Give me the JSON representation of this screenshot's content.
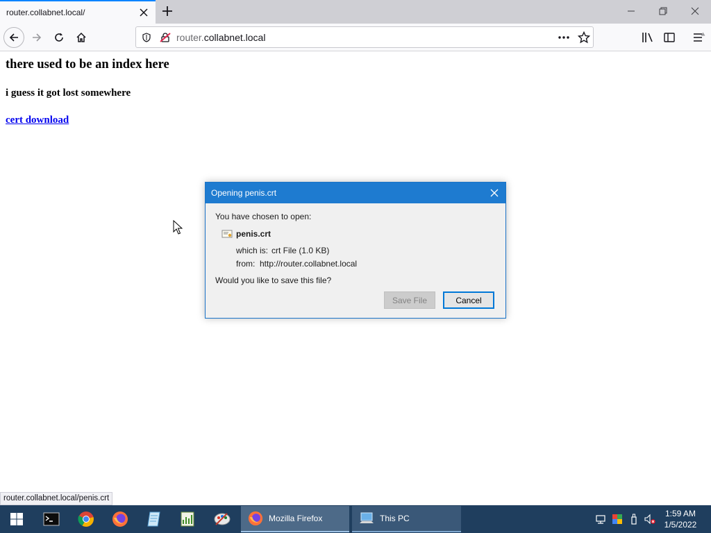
{
  "browser": {
    "tab_title": "router.collabnet.local/",
    "url_prefix": "router.",
    "url_host": "collabnet.local"
  },
  "page": {
    "heading": "there used to be an index here",
    "subheading": "i guess it got lost somewhere",
    "link_text": "cert download"
  },
  "status_bar": "router.collabnet.local/penis.crt",
  "dialog": {
    "title": "Opening penis.crt",
    "intro": "You have chosen to open:",
    "filename": "penis.crt",
    "which_is_label": "which is:",
    "which_is_value": "crt File (1.0 KB)",
    "from_label": "from:",
    "from_value": "http://router.collabnet.local",
    "question": "Would you like to save this file?",
    "save_button": "Save File",
    "cancel_button": "Cancel"
  },
  "taskbar": {
    "apps": [
      {
        "label": "Mozilla Firefox",
        "icon": "firefox-icon",
        "active": true
      },
      {
        "label": "This PC",
        "icon": "this-pc-icon",
        "active": false
      }
    ],
    "pinned_icons": [
      "windows-start-icon",
      "terminal-icon",
      "chrome-icon",
      "firefox-icon",
      "notepad-icon",
      "spreadsheet-icon",
      "paint-icon"
    ],
    "clock_time": "1:59 AM",
    "clock_date": "1/5/2022"
  },
  "colors": {
    "accent": "#0a84ff",
    "dialog_titlebar": "#1e7bd0",
    "link": "#0000ee",
    "taskbar": "#1f3e5e"
  }
}
